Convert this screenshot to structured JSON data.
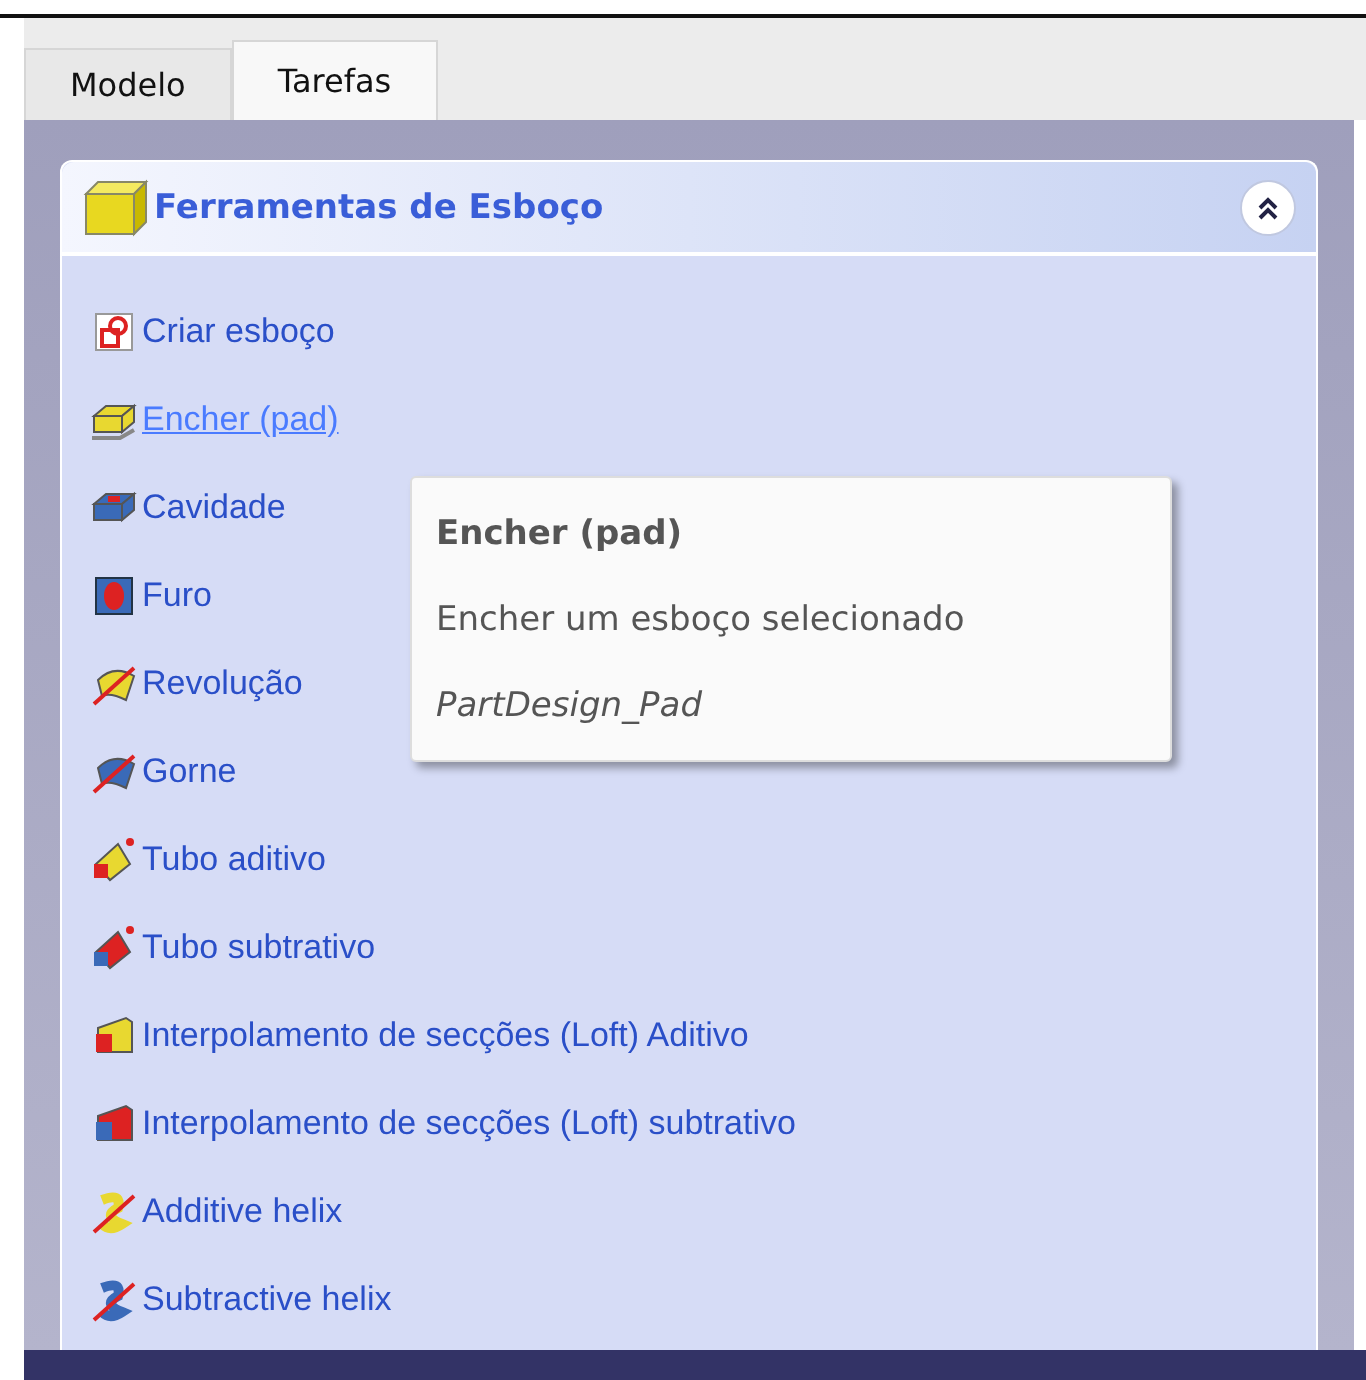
{
  "tabs": [
    {
      "label": "Modelo",
      "selected": false
    },
    {
      "label": "Tarefas",
      "selected": true
    }
  ],
  "panel": {
    "title": "Ferramentas de Esboço",
    "expanded": true,
    "items": [
      {
        "label": "Criar esboço",
        "kind": "sketch",
        "hovered": false
      },
      {
        "label": "Encher (pad)",
        "kind": "pad",
        "hovered": true
      },
      {
        "label": "Cavidade",
        "kind": "pocket",
        "hovered": false
      },
      {
        "label": "Furo",
        "kind": "hole",
        "hovered": false
      },
      {
        "label": "Revolução",
        "kind": "revolution",
        "hovered": false
      },
      {
        "label": "Gorne",
        "kind": "groove",
        "hovered": false
      },
      {
        "label": "Tubo aditivo",
        "kind": "pipe_add",
        "hovered": false
      },
      {
        "label": "Tubo subtrativo",
        "kind": "pipe_sub",
        "hovered": false
      },
      {
        "label": "Interpolamento de secções (Loft) Aditivo",
        "kind": "loft_add",
        "hovered": false
      },
      {
        "label": "Interpolamento de secções (Loft) subtrativo",
        "kind": "loft_sub",
        "hovered": false
      },
      {
        "label": "Additive helix",
        "kind": "helix_add",
        "hovered": false
      },
      {
        "label": "Subtractive helix",
        "kind": "helix_sub",
        "hovered": false
      }
    ]
  },
  "tooltip": {
    "title": "Encher (pad)",
    "description": "Encher um esboço selecionado",
    "command": "PartDesign_Pad"
  }
}
